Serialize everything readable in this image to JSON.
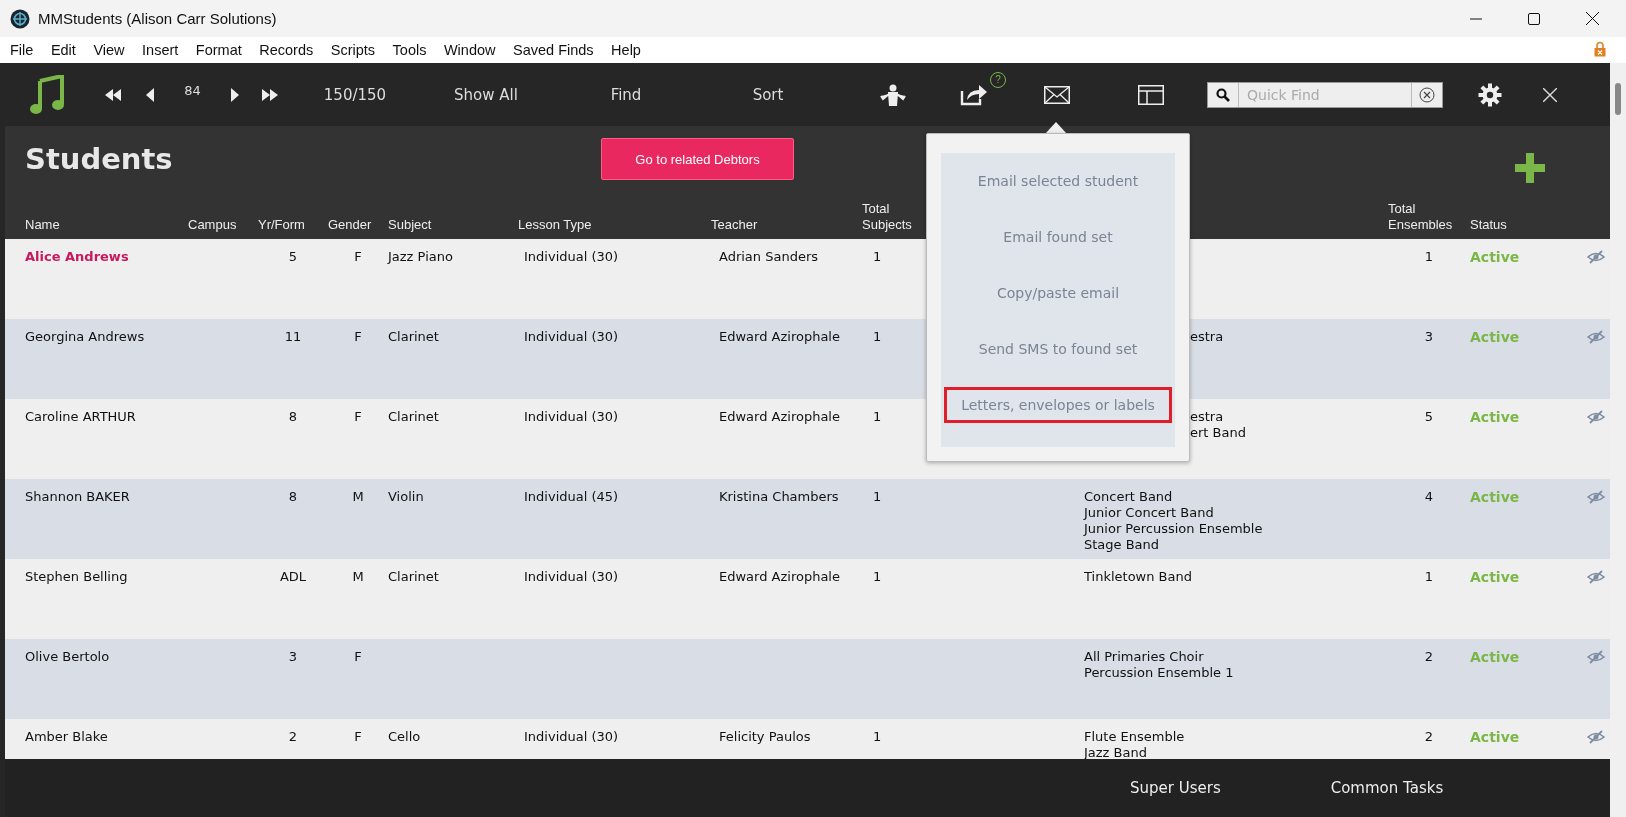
{
  "window": {
    "title": "MMStudents (Alison Carr Solutions)"
  },
  "menu": [
    "File",
    "Edit",
    "View",
    "Insert",
    "Format",
    "Records",
    "Scripts",
    "Tools",
    "Window",
    "Saved Finds",
    "Help"
  ],
  "toolbar": {
    "record_number": "84",
    "record_count": "150/150",
    "buttons": [
      "Show All",
      "Find",
      "Sort"
    ],
    "help_badge": "?",
    "quick_find": {
      "placeholder": "Quick Find"
    }
  },
  "page": {
    "title": "Students",
    "action_button": "Go to related Debtors"
  },
  "table": {
    "columns": {
      "name": "Name",
      "campus": "Campus",
      "yr": "Yr/Form",
      "gender": "Gender",
      "subject": "Subject",
      "lesson_type": "Lesson Type",
      "teacher": "Teacher",
      "total_subjects": "Total Subjects",
      "total_ensembles": "Total Ensembles",
      "status": "Status"
    },
    "rows": [
      {
        "name": "Alice Andrews",
        "yr": "5",
        "gender": "F",
        "subject": "Jazz Piano",
        "lesson_type": "Individual (30)",
        "teacher": "Adrian Sanders",
        "total_subjects": "1",
        "ensembles": [],
        "covered": true,
        "total_ensembles": "1",
        "status": "Active",
        "selected": true
      },
      {
        "name": "Georgina Andrews",
        "yr": "11",
        "gender": "F",
        "subject": "Clarinet",
        "lesson_type": "Individual (30)",
        "teacher": "Edward Azirophale",
        "total_subjects": "1",
        "ensembles": [
          "estra"
        ],
        "covered": true,
        "total_ensembles": "3",
        "status": "Active",
        "selected": false
      },
      {
        "name": "Caroline ARTHUR",
        "yr": "8",
        "gender": "F",
        "subject": "Clarinet",
        "lesson_type": "Individual (30)",
        "teacher": "Edward Azirophale",
        "total_subjects": "1",
        "ensembles": [
          "estra",
          "ert Band"
        ],
        "covered": true,
        "total_ensembles": "5",
        "status": "Active",
        "selected": false
      },
      {
        "name": "Shannon BAKER",
        "yr": "8",
        "gender": "M",
        "subject": "Violin",
        "lesson_type": "Individual (45)",
        "teacher": "Kristina Chambers",
        "total_subjects": "1",
        "ensembles": [
          "Concert Band",
          "Junior Concert Band",
          "Junior Percussion Ensemble",
          "Stage Band"
        ],
        "covered": false,
        "total_ensembles": "4",
        "status": "Active",
        "selected": false
      },
      {
        "name": "Stephen Belling",
        "yr": "ADL",
        "gender": "M",
        "subject": "Clarinet",
        "lesson_type": "Individual (30)",
        "teacher": "Edward Azirophale",
        "total_subjects": "1",
        "ensembles": [
          "Tinkletown Band"
        ],
        "covered": false,
        "total_ensembles": "1",
        "status": "Active",
        "selected": false
      },
      {
        "name": "Olive Bertolo",
        "yr": "3",
        "gender": "F",
        "ensembles": [
          "All Primaries Choir",
          "Percussion Ensemble 1"
        ],
        "covered": false,
        "total_ensembles": "2",
        "status": "Active",
        "selected": false
      },
      {
        "name": "Amber Blake",
        "yr": "2",
        "gender": "F",
        "subject": "Cello",
        "lesson_type": "Individual (30)",
        "teacher": "Felicity Paulos",
        "total_subjects": "1",
        "ensembles": [
          "Flute Ensemble",
          "Jazz Band"
        ],
        "covered": false,
        "total_ensembles": "2",
        "status": "Active",
        "selected": false
      }
    ]
  },
  "email_menu": {
    "items": [
      {
        "label": "Email selected student",
        "selected": false
      },
      {
        "label": "Email found set",
        "selected": false
      },
      {
        "label": "Copy/paste email",
        "selected": false
      },
      {
        "label": "Send SMS to found set",
        "selected": false
      },
      {
        "label": "Letters, envelopes or labels",
        "selected": true
      }
    ]
  },
  "footer": {
    "buttons": [
      "Super Users",
      "Common Tasks"
    ]
  }
}
